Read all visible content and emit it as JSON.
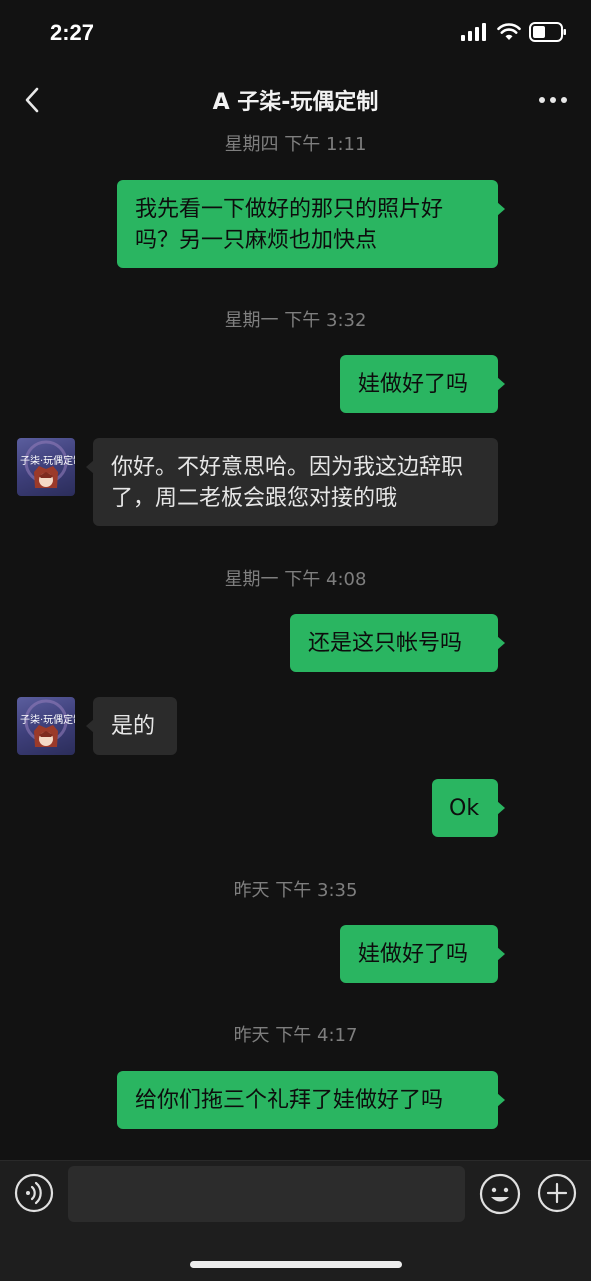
{
  "status": {
    "time": "2:27"
  },
  "header": {
    "title": "A 子柒-玩偶定制"
  },
  "messages": [
    {
      "type": "time",
      "text": "星期四 下午 1:11"
    },
    {
      "type": "out",
      "text": "我先看一下做好的那只的照片好吗？另一只麻烦也加快点"
    },
    {
      "type": "time",
      "text": "星期一 下午 3:32"
    },
    {
      "type": "out",
      "text": "娃做好了吗"
    },
    {
      "type": "in",
      "text": "你好。不好意思哈。因为我这边辞职了，周二老板会跟您对接的哦"
    },
    {
      "type": "time",
      "text": "星期一 下午 4:08"
    },
    {
      "type": "out",
      "text": "还是这只帐号吗"
    },
    {
      "type": "in",
      "text": "是的"
    },
    {
      "type": "out",
      "text": "Ok"
    },
    {
      "type": "time",
      "text": "昨天 下午 3:35"
    },
    {
      "type": "out",
      "text": "娃做好了吗"
    },
    {
      "type": "time",
      "text": "昨天 下午 4:17"
    },
    {
      "type": "out",
      "text": "给你们拖三个礼拜了娃做好了吗"
    }
  ],
  "avatar": {
    "caption": "子柒·玩偶定制"
  },
  "input": {
    "placeholder": ""
  },
  "colors": {
    "outgoing": "#2ab561",
    "incoming": "#2b2b2b",
    "background": "#121212"
  },
  "icons": [
    "back-icon",
    "more-icon",
    "voice-icon",
    "emoji-icon",
    "plus-icon",
    "signal-icon",
    "wifi-icon",
    "battery-icon"
  ]
}
